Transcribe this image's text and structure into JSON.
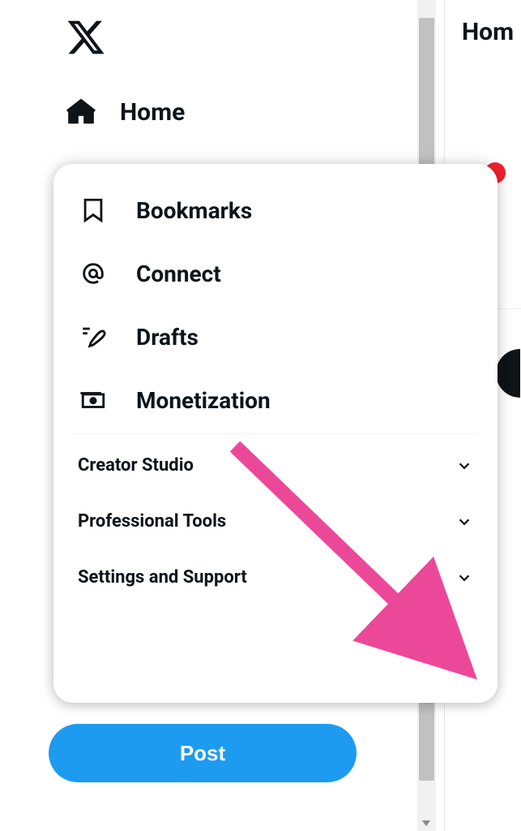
{
  "nav": {
    "home_label": "Home"
  },
  "popup": {
    "items": [
      {
        "label": "Bookmarks"
      },
      {
        "label": "Connect"
      },
      {
        "label": "Drafts"
      },
      {
        "label": "Monetization"
      }
    ],
    "expandables": [
      {
        "label": "Creator Studio"
      },
      {
        "label": "Professional Tools"
      },
      {
        "label": "Settings and Support"
      }
    ]
  },
  "post_button_label": "Post",
  "feed": {
    "header_partial": "Hom"
  }
}
